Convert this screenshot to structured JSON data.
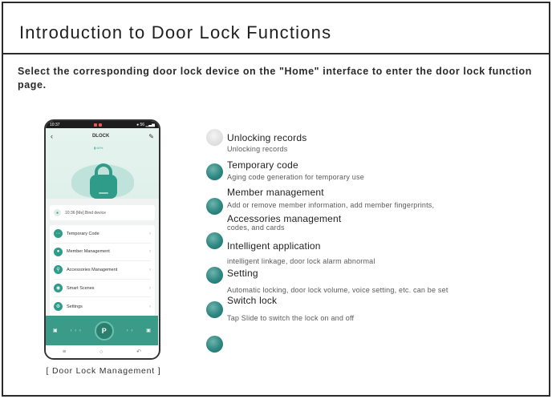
{
  "page": {
    "title": "Introduction to Door Lock Functions",
    "intro": "Select the corresponding door lock device on the \"Home\" interface to enter the door lock function page."
  },
  "phone": {
    "status_time": "10:37",
    "status_right": "● 56 ▁▃▅",
    "app_title": "DLOCK",
    "battery": "▮ 60%",
    "notice": "10:36 [Me] Bind device",
    "menu": [
      {
        "label": "Temporary Code",
        "icon": "grid-icon"
      },
      {
        "label": "Member Management",
        "icon": "user-icon"
      },
      {
        "label": "Accessories Management",
        "icon": "key-icon"
      },
      {
        "label": "Smart Scenes",
        "icon": "scene-icon"
      },
      {
        "label": "Settings",
        "icon": "gear-icon"
      }
    ],
    "slide_left_arrows": "‹ ‹ ‹",
    "slide_right_arrows": "› ›",
    "knob_glyph": "P",
    "caption": "[ Door Lock Management ]"
  },
  "features": {
    "f1_title": "Unlocking records",
    "f1_desc": "Unlocking records",
    "f2_title": "Temporary code",
    "f2_desc": "Aging code generation for temporary use",
    "f3_title": "Member management",
    "f3_desc": "Add or remove member information, add member fingerprints,",
    "f4_title": "Accessories management",
    "f4_desc": "codes, and cards",
    "f5_title": "Intelligent application",
    "f5_desc": "intelligent linkage, door lock alarm abnormal",
    "f6_title": "Setting",
    "f6_desc": "Automatic locking, door lock volume, voice setting, etc. can be set",
    "f7_title": "Switch lock",
    "f7_desc": "Tap Slide to switch the lock on and off"
  },
  "colors": {
    "accent": "#2f9c8a",
    "dot": "#2d8781"
  }
}
